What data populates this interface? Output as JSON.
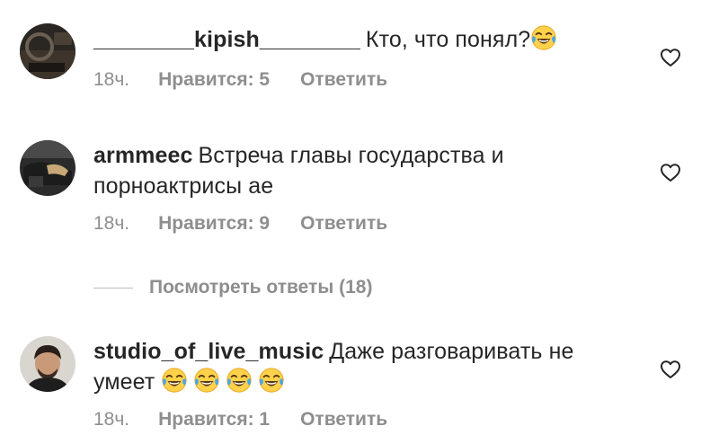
{
  "comments": [
    {
      "username": "________kipish________",
      "text": "Кто, что понял?",
      "emoji_count": 1,
      "time": "18ч.",
      "likes": "Нравится: 5",
      "reply": "Ответить"
    },
    {
      "username": "armmeec",
      "text": "Встреча главы государства и порноактрисы ае",
      "emoji_count": 0,
      "time": "18ч.",
      "likes": "Нравится: 9",
      "reply": "Ответить"
    },
    {
      "username": "studio_of_live_music",
      "text": "Даже разговаривать не умеет",
      "emoji_count": 4,
      "time": "18ч.",
      "likes": "Нравится: 1",
      "reply": "Ответить"
    }
  ],
  "view_replies": "Посмотреть ответы (18)",
  "icons": {
    "like": "heart-outline-icon",
    "emoji": "face-with-tears-of-joy-emoji"
  },
  "colors": {
    "text": "#262626",
    "secondary": "#8e8e8e",
    "background": "#ffffff"
  }
}
